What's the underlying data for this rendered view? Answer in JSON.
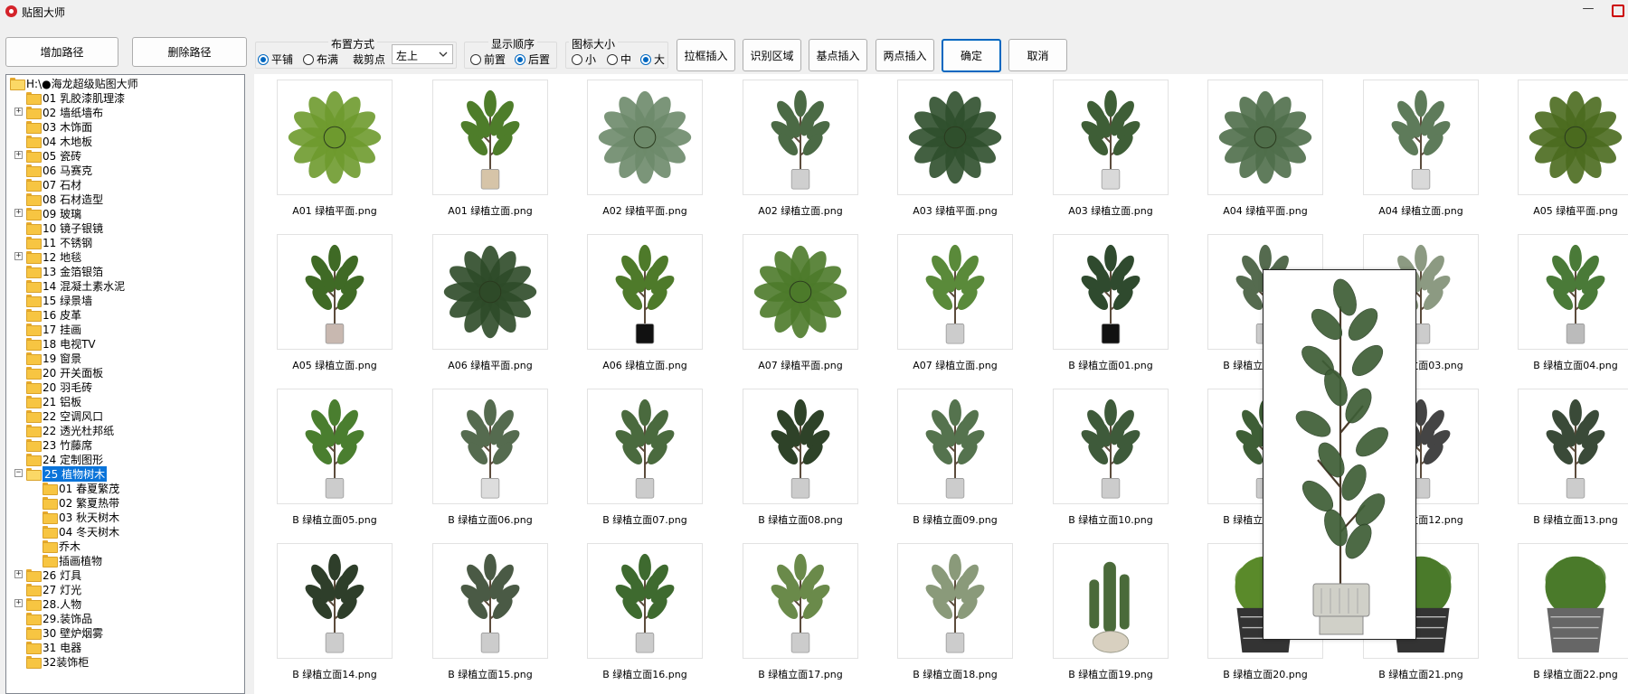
{
  "window": {
    "title": "贴图大师"
  },
  "toolbar": {
    "add_path": "增加路径",
    "delete_path": "删除路径",
    "layout": {
      "label": "布置方式",
      "options": [
        "平铺",
        "布满"
      ],
      "selected": "平铺",
      "crop_label": "裁剪点",
      "crop_value": "左上"
    },
    "order": {
      "label": "显示顺序",
      "options": [
        "前置",
        "后置"
      ],
      "selected": "后置"
    },
    "icon_size": {
      "label": "图标大小",
      "options": [
        "小",
        "中",
        "大"
      ],
      "selected": "大"
    },
    "btn_frame": "拉框插入",
    "btn_detect": "识别区域",
    "btn_base": "基点插入",
    "btn_two": "两点插入",
    "btn_ok": "确定",
    "btn_cancel": "取消"
  },
  "tree": {
    "root": "H:\\●海龙超级贴图大师",
    "items": [
      {
        "label": "01 乳胶漆肌理漆",
        "expandable": false
      },
      {
        "label": "02 墙纸墙布",
        "expandable": true
      },
      {
        "label": "03 木饰面",
        "expandable": false
      },
      {
        "label": "04 木地板",
        "expandable": false
      },
      {
        "label": "05 瓷砖",
        "expandable": true
      },
      {
        "label": "06 马赛克",
        "expandable": false
      },
      {
        "label": "07 石材",
        "expandable": false
      },
      {
        "label": "08 石材造型",
        "expandable": false
      },
      {
        "label": "09 玻璃",
        "expandable": true
      },
      {
        "label": "10 镜子银镜",
        "expandable": false
      },
      {
        "label": "11 不锈钢",
        "expandable": false
      },
      {
        "label": "12 地毯",
        "expandable": true
      },
      {
        "label": "13 金箔银箔",
        "expandable": false
      },
      {
        "label": "14 混凝土素水泥",
        "expandable": false
      },
      {
        "label": "15 绿景墙",
        "expandable": false
      },
      {
        "label": "16 皮革",
        "expandable": false
      },
      {
        "label": "17 挂画",
        "expandable": false
      },
      {
        "label": "18 电视TV",
        "expandable": false
      },
      {
        "label": "19 窗景",
        "expandable": false
      },
      {
        "label": "20 开关面板",
        "expandable": false
      },
      {
        "label": "20 羽毛砖",
        "expandable": false
      },
      {
        "label": "21 铝板",
        "expandable": false
      },
      {
        "label": "22 空调风口",
        "expandable": false
      },
      {
        "label": "22 透光杜邦纸",
        "expandable": false
      },
      {
        "label": "23 竹藤席",
        "expandable": false
      },
      {
        "label": "24 定制图形",
        "expandable": false
      },
      {
        "label": "25 植物树木",
        "expandable": true,
        "expanded": true,
        "selected": true
      },
      {
        "label": "01 春夏繁茂",
        "child": true
      },
      {
        "label": "02 繁夏热带",
        "child": true
      },
      {
        "label": "03 秋天树木",
        "child": true
      },
      {
        "label": "04 冬天树木",
        "child": true
      },
      {
        "label": "乔木",
        "child": true
      },
      {
        "label": "插画植物",
        "child": true
      },
      {
        "label": "26 灯具",
        "expandable": true
      },
      {
        "label": "27 灯光",
        "expandable": false
      },
      {
        "label": "28.人物",
        "expandable": true
      },
      {
        "label": "29.装饰品",
        "expandable": false
      },
      {
        "label": "30 壁炉烟雾",
        "expandable": false
      },
      {
        "label": "31 电器",
        "expandable": false
      },
      {
        "label": "32装饰柜",
        "expandable": false
      }
    ]
  },
  "thumbnails": [
    {
      "label": "A01 绿植平面.png",
      "kind": "top",
      "color": "#6e9a2e",
      "pot": ""
    },
    {
      "label": "A01 绿植立面.png",
      "kind": "upright",
      "color": "#4e7d2a",
      "pot": "#d6c4a8"
    },
    {
      "label": "A02 绿植平面.png",
      "kind": "top",
      "color": "#6d8a6a",
      "pot": ""
    },
    {
      "label": "A02 绿植立面.png",
      "kind": "upright",
      "color": "#4b6a45",
      "pot": "#cfcfcf"
    },
    {
      "label": "A03 绿植平面.png",
      "kind": "top",
      "color": "#2f4f2c",
      "pot": ""
    },
    {
      "label": "A03 绿植立面.png",
      "kind": "upright",
      "color": "#3e5e36",
      "pot": "#d9d9d9"
    },
    {
      "label": "A04 绿植平面.png",
      "kind": "top",
      "color": "#4f6e4a",
      "pot": ""
    },
    {
      "label": "A04 绿植立面.png",
      "kind": "upright",
      "color": "#5e7b5a",
      "pot": "#d9d9d9"
    },
    {
      "label": "A05 绿植平面.png",
      "kind": "top",
      "color": "#4a6a1e",
      "pot": ""
    },
    {
      "label": "A05 绿植立面.png",
      "kind": "upright",
      "color": "#3f6a25",
      "pot": "#c8b8b0"
    },
    {
      "label": "A06 绿植平面.png",
      "kind": "top",
      "color": "#2e4a28",
      "pot": ""
    },
    {
      "label": "A06 绿植立面.png",
      "kind": "upright",
      "color": "#4e7a2a",
      "pot": "#111111"
    },
    {
      "label": "A07 绿植平面.png",
      "kind": "top",
      "color": "#4c7a2a",
      "pot": ""
    },
    {
      "label": "A07 绿植立面.png",
      "kind": "upright",
      "color": "#5a8a3a",
      "pot": "#cccccc"
    },
    {
      "label": "B 绿植立面01.png",
      "kind": "upright",
      "color": "#2f4a2e",
      "pot": "#111111"
    },
    {
      "label": "B 绿植立面02.png",
      "kind": "upright",
      "color": "#556b4f",
      "pot": "#cccccc"
    },
    {
      "label": "B 绿植立面03.png",
      "kind": "upright",
      "color": "#8c9a82",
      "pot": "#cccccc"
    },
    {
      "label": "B 绿植立面04.png",
      "kind": "upright",
      "color": "#4a7a38",
      "pot": "#bbbbbb"
    },
    {
      "label": "B 绿植立面05.png",
      "kind": "upright",
      "color": "#4a7e2f",
      "pot": "#cccccc"
    },
    {
      "label": "B 绿植立面06.png",
      "kind": "upright",
      "color": "#556b4f",
      "pot": "#dddddd"
    },
    {
      "label": "B 绿植立面07.png",
      "kind": "upright",
      "color": "#4a6a3e",
      "pot": "#cccccc"
    },
    {
      "label": "B 绿植立面08.png",
      "kind": "upright",
      "color": "#2e4228",
      "pot": "#cccccc"
    },
    {
      "label": "B 绿植立面09.png",
      "kind": "upright",
      "color": "#55734e",
      "pot": "#cccccc"
    },
    {
      "label": "B 绿植立面10.png",
      "kind": "upright",
      "color": "#3e5a3a",
      "pot": "#cccccc"
    },
    {
      "label": "B 绿植立面11.png",
      "kind": "upright",
      "color": "#3e5e36",
      "pot": "#cccccc"
    },
    {
      "label": "B 绿植立面12.png",
      "kind": "upright",
      "color": "#444444",
      "pot": "#cccccc"
    },
    {
      "label": "B 绿植立面13.png",
      "kind": "upright",
      "color": "#3a4a38",
      "pot": "#cccccc"
    },
    {
      "label": "B 绿植立面14.png",
      "kind": "upright",
      "color": "#2e3e2a",
      "pot": "#cccccc"
    },
    {
      "label": "B 绿植立面15.png",
      "kind": "upright",
      "color": "#4a5a45",
      "pot": "#cccccc"
    },
    {
      "label": "B 绿植立面16.png",
      "kind": "upright",
      "color": "#3e6a2f",
      "pot": "#cccccc"
    },
    {
      "label": "B 绿植立面17.png",
      "kind": "upright",
      "color": "#6a8a4a",
      "pot": "#cccccc"
    },
    {
      "label": "B 绿植立面18.png",
      "kind": "upright",
      "color": "#8a9a7a",
      "pot": "#cccccc"
    },
    {
      "label": "B 绿植立面19.png",
      "kind": "cactus",
      "color": "#4a6a3a",
      "pot": "#d8d0c0"
    },
    {
      "label": "B 绿植立面20.png",
      "kind": "bush",
      "color": "#5a8a2a",
      "pot": "#333333"
    },
    {
      "label": "B 绿植立面21.png",
      "kind": "bush",
      "color": "#4a7a2a",
      "pot": "#333333"
    },
    {
      "label": "B 绿植立面22.png",
      "kind": "bush",
      "color": "#4a7a2a",
      "pot": "#666666"
    }
  ],
  "preview": {
    "color": "#3e5e36",
    "pot": "#d0d0c8"
  }
}
